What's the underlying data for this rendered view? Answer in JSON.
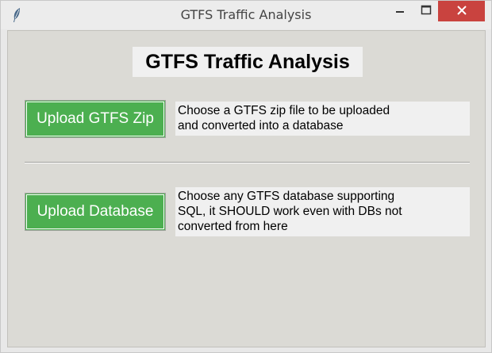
{
  "window": {
    "title": "GTFS Traffic Analysis",
    "icon": "feather-icon"
  },
  "main": {
    "heading": "GTFS Traffic Analysis",
    "upload_zip": {
      "button_label": "Upload GTFS Zip",
      "description_lines": [
        "Choose a GTFS zip file to be uploaded",
        "and converted into a database"
      ]
    },
    "upload_db": {
      "button_label": "Upload Database",
      "description_lines": [
        "Choose any GTFS database supporting",
        "SQL, it SHOULD work even with DBs not",
        "converted from here"
      ]
    }
  },
  "colors": {
    "button_green": "#4caf50",
    "close_red": "#c9433f"
  }
}
